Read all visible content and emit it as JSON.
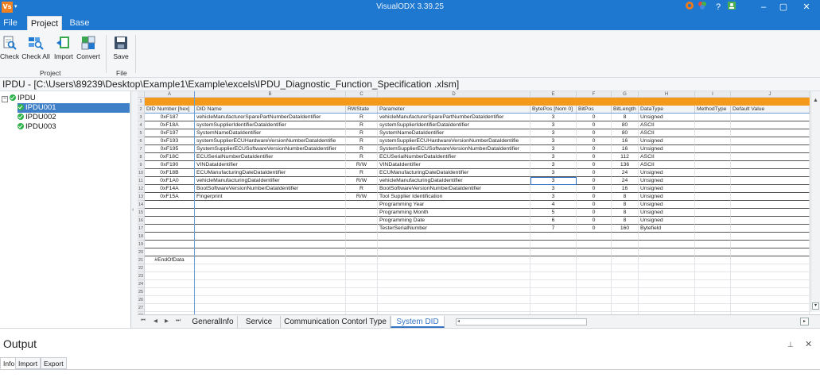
{
  "window": {
    "title": "VisualODX 3.39.25",
    "app_icon": "Vs",
    "quick_access": "▾",
    "accent": "#1e78d0"
  },
  "ribbon": {
    "tabs": [
      "File",
      "Project",
      "Base"
    ],
    "active_tab": "Project",
    "buttons": [
      {
        "label": "Check",
        "icon": "check-icon"
      },
      {
        "label": "Check All",
        "icon": "check-all-icon"
      },
      {
        "label": "Import",
        "icon": "import-icon"
      },
      {
        "label": "Convert",
        "icon": "convert-icon"
      },
      {
        "label": "Save",
        "icon": "save-icon"
      }
    ],
    "groups": [
      "Project",
      "File"
    ]
  },
  "path": "IPDU - [C:\\Users\\89239\\Desktop\\Example1\\Example\\excels\\IPDU_Diagnostic_Function_Specification .xlsm]",
  "tree": {
    "root": "IPDU",
    "children": [
      "IPDU001",
      "IPDU002",
      "IPDU003"
    ],
    "selected": "IPDU001"
  },
  "sheet": {
    "columns": [
      "A",
      "B",
      "C",
      "D",
      "E",
      "F",
      "G",
      "H",
      "I",
      "J"
    ],
    "headers": [
      "DID Number [hex]",
      "DID Name",
      "RWState",
      "Parameter",
      "BytePos [Nom 0]",
      "BitPos",
      "BitLength",
      "DataType",
      "MethodType",
      "Default Value"
    ],
    "rows": [
      [
        "0xF187",
        "vehicleManufacturerSparePartNumberDataIdentifier",
        "R",
        "vehicleManufacturerSparePartNumberDataIdentifier",
        "3",
        "0",
        "8",
        "Unsigned",
        "",
        ""
      ],
      [
        "0xF18A",
        "systemSupplierIdentifierDataIdentifier",
        "R",
        "systemSupplierIdentifierDataIdentifier",
        "3",
        "0",
        "80",
        "ASCII",
        "",
        ""
      ],
      [
        "0xF197",
        "SystemNameDataIdentifier",
        "R",
        "SystemNameDataIdentifier",
        "3",
        "0",
        "80",
        "ASCII",
        "",
        ""
      ],
      [
        "0xF193",
        "systemSupplierECUHardwareVersionNumberDataIdentifie",
        "R",
        "systemSupplierECUHardwareVersionNumberDataIdentifie",
        "3",
        "0",
        "16",
        "Unsigned",
        "",
        ""
      ],
      [
        "0xF195",
        "SystemSupplierECUSoftwareVersionNumberDataIdentifier",
        "R",
        "SystemSupplierECUSoftwareVersionNumberDataIdentifier",
        "3",
        "0",
        "16",
        "Unsigned",
        "",
        ""
      ],
      [
        "0xF18C",
        "ECUSerialNumberDataIdentifier",
        "R",
        "ECUSerialNumberDataIdentifier",
        "3",
        "0",
        "112",
        "ASCII",
        "",
        ""
      ],
      [
        "0xF190",
        "VINDataIdentifier",
        "R/W",
        "VINDataIdentifier",
        "3",
        "0",
        "136",
        "ASCII",
        "",
        ""
      ],
      [
        "0xF18B",
        "ECUManufacturingDateDataIdentifier",
        "R",
        "ECUManufacturingDateDataIdentifier",
        "3",
        "0",
        "24",
        "Unsigned",
        "",
        ""
      ],
      [
        "0xF1A0",
        "vehicleManufacturingDataIdentifier",
        "R/W",
        "vehicleManufacturingDataIdentifier",
        "3",
        "0",
        "24",
        "Unsigned",
        "",
        ""
      ],
      [
        "0xF14A",
        "BootSoftwareVersionNumberDataIdentifier",
        "R",
        "BootSoftwareVersionNumberDataIdentifier",
        "3",
        "0",
        "16",
        "Unsigned",
        "",
        ""
      ],
      [
        "0xF15A",
        "Fingerprint",
        "R/W",
        "Tool Supplier Identification",
        "3",
        "0",
        "8",
        "Unsigned",
        "",
        ""
      ],
      [
        "",
        "",
        "",
        "Programming Year",
        "4",
        "0",
        "8",
        "Unsigned",
        "",
        ""
      ],
      [
        "",
        "",
        "",
        "Programming Month",
        "5",
        "0",
        "8",
        "Unsigned",
        "",
        ""
      ],
      [
        "",
        "",
        "",
        "Programming Date",
        "6",
        "0",
        "8",
        "Unsigned",
        "",
        ""
      ],
      [
        "",
        "",
        "",
        "TesterSerialNumber",
        "7",
        "0",
        "160",
        "Bytefield",
        "",
        ""
      ],
      [
        "",
        "",
        "",
        "",
        "",
        "",
        "",
        "",
        "",
        ""
      ],
      [
        "",
        "",
        "",
        "",
        "",
        "",
        "",
        "",
        "",
        ""
      ],
      [
        "",
        "",
        "",
        "",
        "",
        "",
        "",
        "",
        "",
        ""
      ],
      [
        "#EndOfData",
        "",
        "",
        "",
        "",
        "",
        "",
        "",
        "",
        ""
      ]
    ],
    "row_numbers": [
      "1",
      "2",
      "3",
      "4",
      "5",
      "6",
      "7",
      "8",
      "9",
      "10",
      "11",
      "12",
      "13",
      "14",
      "15",
      "16",
      "17",
      "18",
      "19",
      "20",
      "21",
      "22",
      "23",
      "24",
      "25",
      "26",
      "27",
      "28"
    ],
    "tabs": [
      "GeneralInfo",
      "Service",
      "Communication Contorl Type",
      "System DID"
    ],
    "active_tab": "System DID",
    "header_color": "#f39a1b",
    "tab_nav": [
      "⏮",
      "◀",
      "▶",
      "⏭"
    ]
  },
  "output": {
    "title": "Output",
    "tabs": [
      "Info",
      "Import",
      "Export"
    ],
    "active_tab": "Info"
  }
}
